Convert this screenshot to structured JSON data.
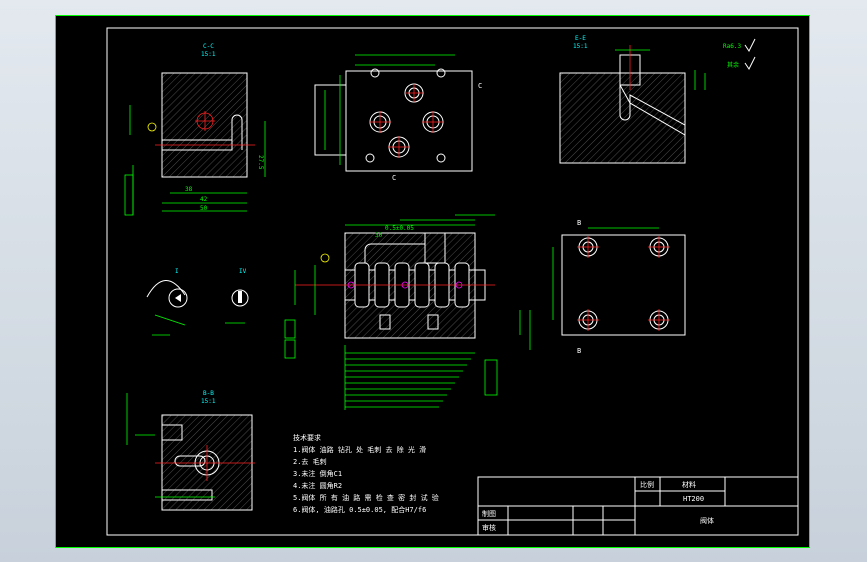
{
  "views": {
    "section_cc": {
      "label": "C-C",
      "scale": "15:1"
    },
    "section_ee": {
      "label": "E-E",
      "scale": "15:1"
    },
    "section_bb": {
      "label": "B-B",
      "scale": "15:1"
    },
    "detail_1": {
      "label": "I"
    },
    "detail_2": {
      "label": "IV"
    }
  },
  "dimensions": {
    "d42": "42",
    "d50": "50",
    "d38": "38",
    "d27": "27.5",
    "d30": "30",
    "d0505": "0.5±0.05"
  },
  "notes": {
    "title": "技术要求",
    "lines": [
      "1.阀体 油路 钻孔 处 毛刺 去 除 光 滑",
      "2.去 毛刺",
      "3.未注 倒角C1",
      "4.未注 圆角R2",
      "5.阀体 所 有 油 路 需 检 查 密 封 试 验",
      "6.阀体, 油路孔 0.5±0.05, 配合H7/f6"
    ]
  },
  "title_block": {
    "scale_label": "比例",
    "material_label": "材料",
    "material_value": "HT200",
    "drawn_label": "制图",
    "checked_label": "审核",
    "part_name": "阀体"
  },
  "labels": {
    "roughness_1": "Ra6.3",
    "roughness_2": "其余",
    "view_c": "C",
    "view_e": "E",
    "view_b": "B"
  }
}
